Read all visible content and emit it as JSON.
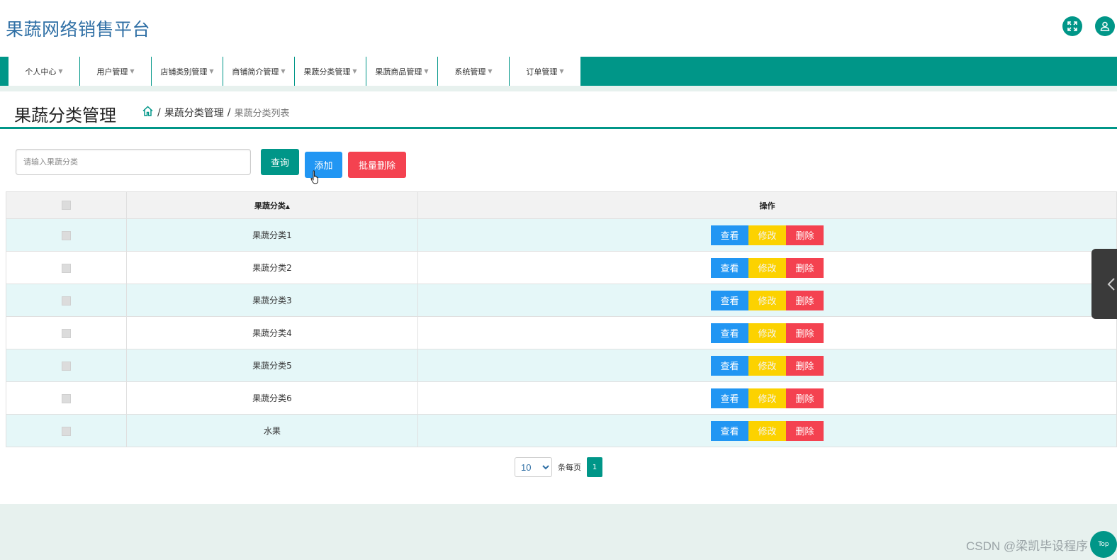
{
  "header": {
    "app_title": "果蔬网络销售平台",
    "fullscreen_icon": "fullscreen-icon",
    "user_icon": "user-icon"
  },
  "nav": {
    "items": [
      {
        "label": "个人中心"
      },
      {
        "label": "用户管理"
      },
      {
        "label": "店铺类别管理"
      },
      {
        "label": "商铺简介管理"
      },
      {
        "label": "果蔬分类管理"
      },
      {
        "label": "果蔬商品管理"
      },
      {
        "label": "系统管理"
      },
      {
        "label": "订单管理"
      }
    ]
  },
  "page": {
    "title": "果蔬分类管理",
    "breadcrumb": {
      "home_icon": "home-icon",
      "level1": "果蔬分类管理",
      "level2": "果蔬分类列表",
      "separator": "/"
    }
  },
  "search": {
    "placeholder": "请输入果蔬分类",
    "value": "",
    "query_label": "查询",
    "add_label": "添加",
    "batch_delete_label": "批量删除"
  },
  "table": {
    "headers": {
      "category": "果蔬分类",
      "sort_icon": "sort-icon",
      "actions": "操作"
    },
    "actions": {
      "view": "查看",
      "edit": "修改",
      "delete": "删除"
    },
    "rows": [
      {
        "category": "果蔬分类1"
      },
      {
        "category": "果蔬分类2"
      },
      {
        "category": "果蔬分类3"
      },
      {
        "category": "果蔬分类4"
      },
      {
        "category": "果蔬分类5"
      },
      {
        "category": "果蔬分类6"
      },
      {
        "category": "水果"
      }
    ]
  },
  "pagination": {
    "page_size": "10",
    "per_page_label": "条每页",
    "current_page": "1"
  },
  "overlay": {
    "watermark": "CSDN @梁凯毕设程序",
    "back_to_top": "Top"
  },
  "colors": {
    "primary": "#009688",
    "blue": "#2196f3",
    "yellow": "#fcd200",
    "red": "#f44250",
    "title_blue": "#2f6fa5",
    "row_tint": "#e5f7f8"
  }
}
